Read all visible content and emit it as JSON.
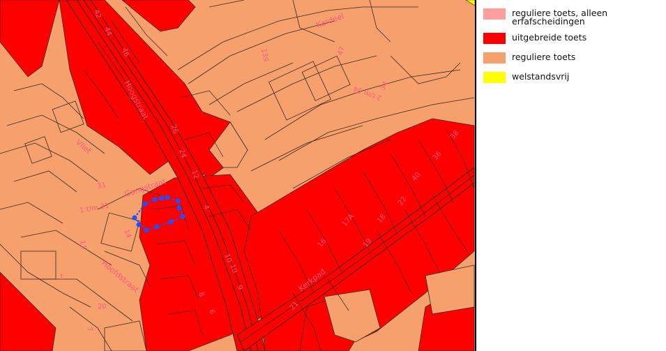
{
  "legend": {
    "items": [
      {
        "label": "reguliere toets, alleen erfafscheidingen",
        "color": "#ff9e9e"
      },
      {
        "label": "uitgebreide toets",
        "color": "#ff0000"
      },
      {
        "label": "reguliere toets",
        "color": "#f6a06e"
      },
      {
        "label": "welstandsvrij",
        "color": "#ffff00"
      }
    ]
  },
  "map": {
    "colors": {
      "red": "#ff0000",
      "salmon": "#f6a06e",
      "outline": "#3a2a1a",
      "highlight": "#1e50ff",
      "label": "#ff5a7a"
    },
    "streets": {
      "kardeel": "Kardeel",
      "hoogstraat_top": "Hoogstraat",
      "gangstraat": "Gangstraat",
      "hoofdstraat": "Hoofdstraat",
      "vliet": "Vliet",
      "kerkpad": "Kerkpad"
    },
    "numbers": [
      "139",
      "47",
      "34",
      "26",
      "24",
      "12",
      "10",
      "8",
      "6",
      "4",
      "14",
      "31",
      "11",
      "1",
      "20",
      "7",
      "16",
      "17A",
      "19",
      "21",
      "18",
      "22",
      "10",
      "9",
      "46",
      "44",
      "42",
      "40",
      "36",
      "38",
      "2 t/m 34",
      "1 t/m 31"
    ]
  }
}
